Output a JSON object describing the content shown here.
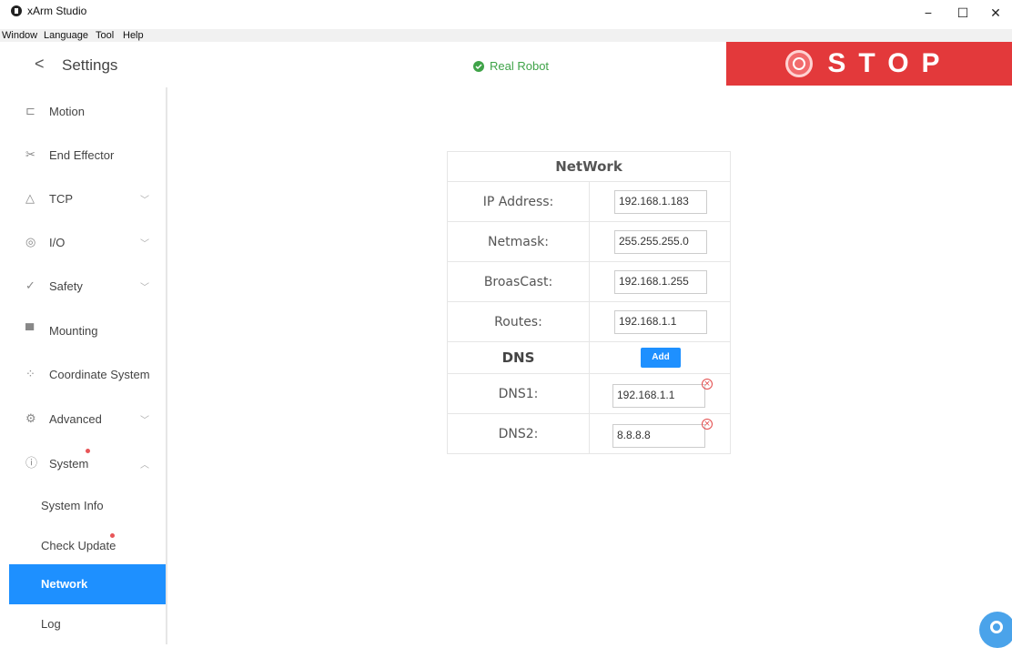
{
  "window": {
    "title": "xArm Studio",
    "minimize": "−",
    "maximize": "☐",
    "close": "✕"
  },
  "menu": [
    "Window",
    "Language",
    "Tool",
    "Help"
  ],
  "header": {
    "back": "<",
    "title": "Settings",
    "status": "Real Robot",
    "stop": "STOP"
  },
  "sidebar": {
    "items": [
      {
        "label": "Motion",
        "icon": "motion-icon"
      },
      {
        "label": "End Effector",
        "icon": "end-effector-icon"
      },
      {
        "label": "TCP",
        "icon": "tcp-icon",
        "chevron": "﹀"
      },
      {
        "label": "I/O",
        "icon": "io-icon",
        "chevron": "﹀"
      },
      {
        "label": "Safety",
        "icon": "safety-icon",
        "chevron": "﹀"
      },
      {
        "label": "Mounting",
        "icon": "mounting-icon"
      },
      {
        "label": "Coordinate System",
        "icon": "coordinate-icon"
      },
      {
        "label": "Advanced",
        "icon": "advanced-icon",
        "chevron": "﹀"
      },
      {
        "label": "System",
        "icon": "system-icon",
        "chevron": "︿"
      }
    ],
    "sub_items": [
      {
        "label": "System Info"
      },
      {
        "label": "Check Update"
      },
      {
        "label": "Network"
      },
      {
        "label": "Log"
      }
    ]
  },
  "network": {
    "title": "NetWork",
    "ip_label": "IP Address:",
    "ip_value": "192.168.1.183",
    "netmask_label": "Netmask:",
    "netmask_value": "255.255.255.0",
    "broadcast_label": "BroasCast:",
    "broadcast_value": "192.168.1.255",
    "routes_label": "Routes:",
    "routes_value": "192.168.1.1",
    "dns_title": "DNS",
    "add_label": "Add",
    "dns1_label": "DNS1:",
    "dns1_value": "192.168.1.1",
    "dns2_label": "DNS2:",
    "dns2_value": "8.8.8.8",
    "remove_glyph": "×"
  },
  "colors": {
    "accent": "#1e90ff",
    "stop": "#e3393b",
    "status_ok": "#3fa348",
    "alert_dot": "#e85558"
  }
}
